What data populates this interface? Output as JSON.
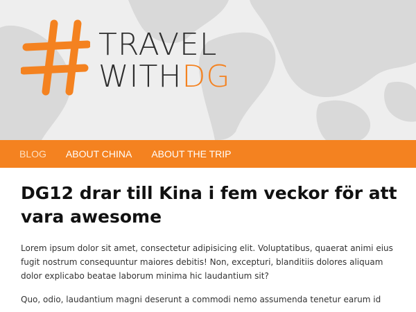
{
  "brand": {
    "hash_symbol": "#",
    "line1": "TRAVEL",
    "line2_prefix": "WITH",
    "line2_accent": "DG",
    "accent_color": "#f48220"
  },
  "nav": {
    "items": [
      {
        "label": "BLOG",
        "active": true
      },
      {
        "label": "ABOUT CHINA",
        "active": false
      },
      {
        "label": "ABOUT THE TRIP",
        "active": false
      }
    ],
    "background_color": "#f48220"
  },
  "post": {
    "title": "DG12 drar till Kina i fem veckor för att vara awesome",
    "paragraphs": [
      "Lorem ipsum dolor sit amet, consectetur adipisicing elit. Voluptatibus, quaerat animi eius fugit nostrum consequuntur maiores debitis! Non, excepturi, blanditiis dolores aliquam dolor explicabo beatae laborum minima hic laudantium sit?",
      "Quo, odio, laudantium magni deserunt a commodi nemo assumenda tenetur earum id"
    ]
  }
}
